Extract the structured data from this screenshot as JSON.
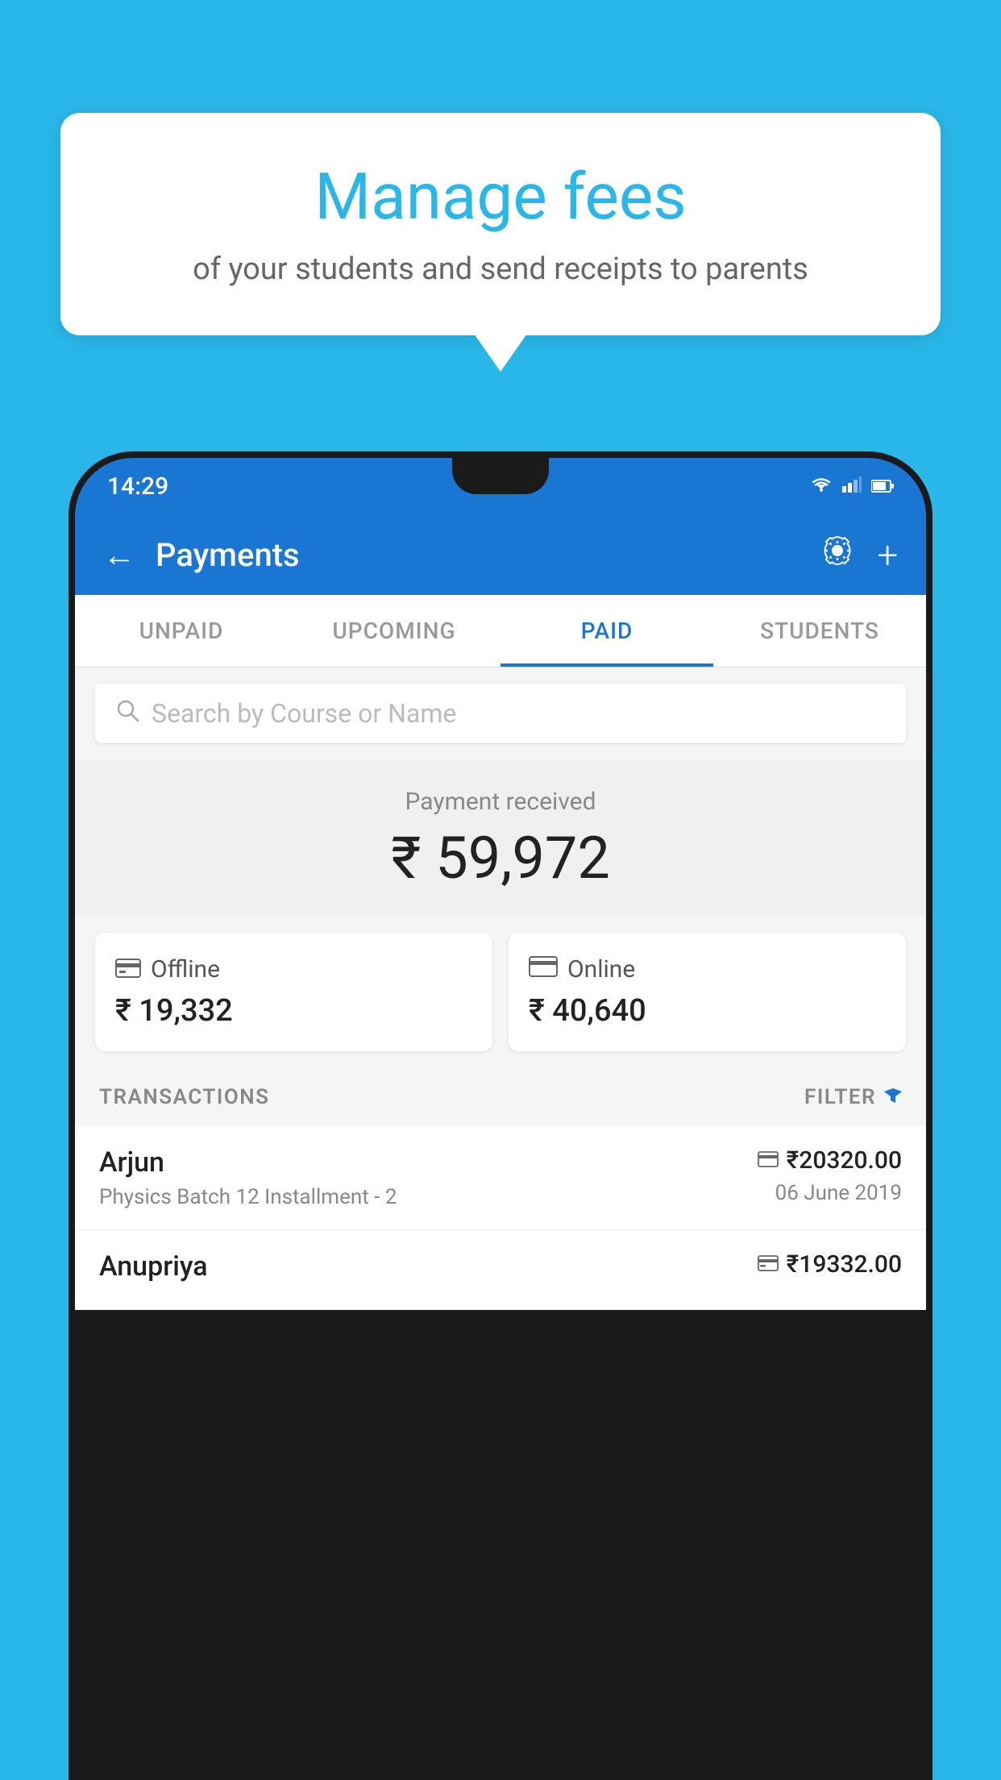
{
  "background": {
    "color": "#29b6e8"
  },
  "speech_bubble": {
    "title": "Manage fees",
    "subtitle": "of your students and send receipts to parents"
  },
  "phone": {
    "status_bar": {
      "time": "14:29",
      "icons": [
        "wifi",
        "signal",
        "battery"
      ]
    },
    "header": {
      "title": "Payments",
      "back_label": "←",
      "gear_label": "⚙",
      "plus_label": "+"
    },
    "tabs": [
      {
        "label": "UNPAID",
        "active": false
      },
      {
        "label": "UPCOMING",
        "active": false
      },
      {
        "label": "PAID",
        "active": true
      },
      {
        "label": "STUDENTS",
        "active": false
      }
    ],
    "search": {
      "placeholder": "Search by Course or Name"
    },
    "payment_received": {
      "label": "Payment received",
      "amount": "₹ 59,972"
    },
    "payment_cards": [
      {
        "icon": "💳",
        "label": "Offline",
        "amount": "₹ 19,332"
      },
      {
        "icon": "💳",
        "label": "Online",
        "amount": "₹ 40,640"
      }
    ],
    "transactions_section": {
      "label": "TRANSACTIONS",
      "filter_label": "FILTER"
    },
    "transactions": [
      {
        "name": "Arjun",
        "course": "Physics Batch 12 Installment - 2",
        "payment_type": "online",
        "amount": "₹20320.00",
        "date": "06 June 2019"
      },
      {
        "name": "Anupriya",
        "course": "",
        "payment_type": "offline",
        "amount": "₹19332.00",
        "date": ""
      }
    ]
  }
}
